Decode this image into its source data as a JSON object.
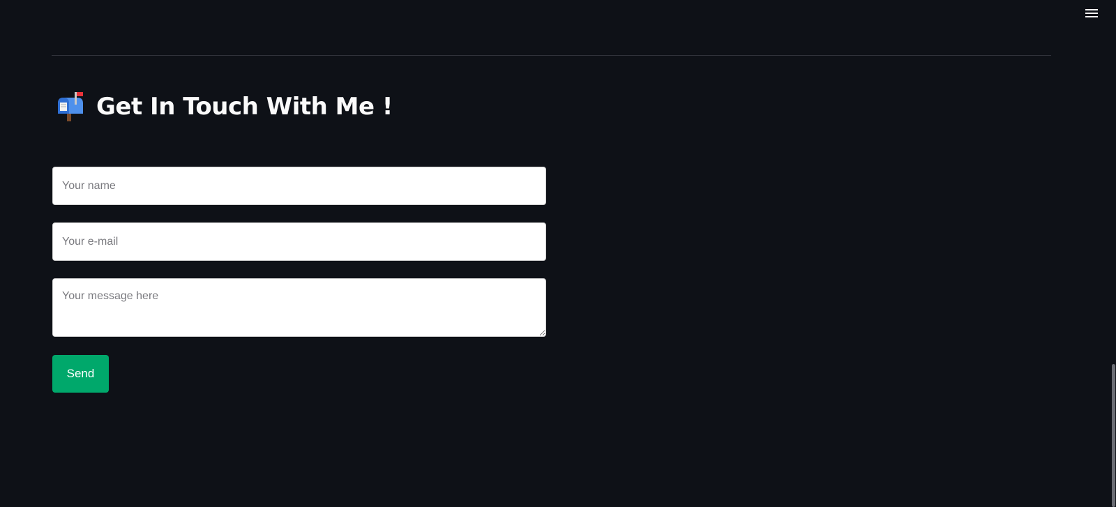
{
  "header": {
    "menu_icon": "hamburger-menu-icon"
  },
  "contact": {
    "icon": "mailbox-icon",
    "title": "Get In Touch With Me !"
  },
  "form": {
    "name_placeholder": "Your name",
    "email_placeholder": "Your e-mail",
    "message_placeholder": "Your message here",
    "send_label": "Send"
  },
  "colors": {
    "background": "#0e1117",
    "button": "#00a86b",
    "text": "#fafafa"
  }
}
